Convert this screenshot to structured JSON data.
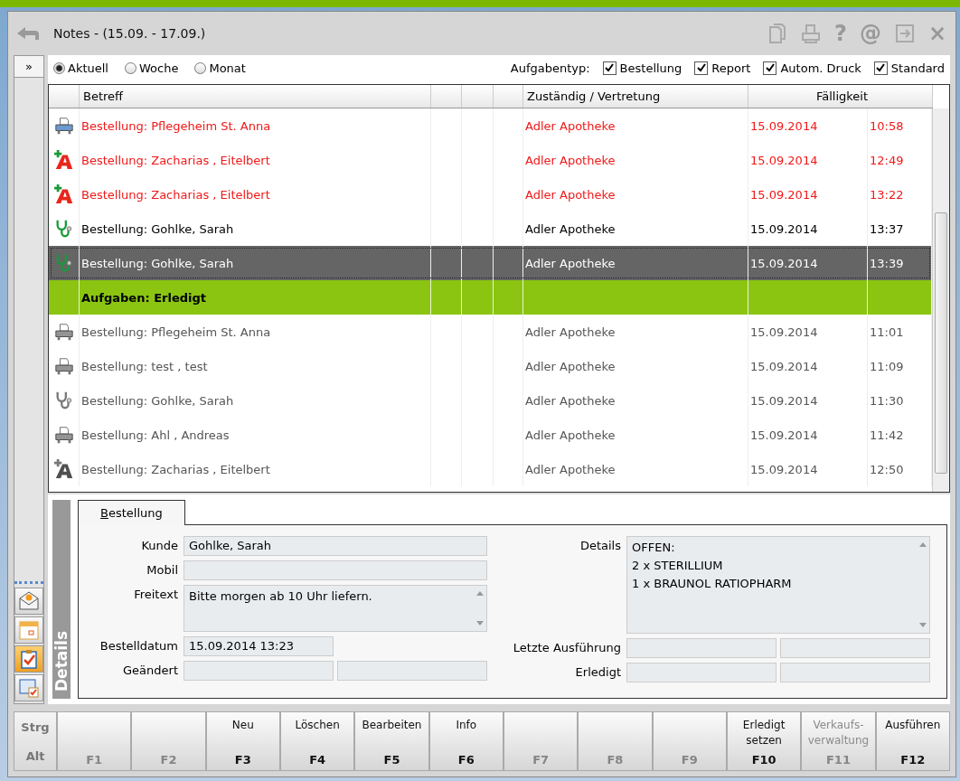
{
  "window": {
    "title": "Notes - (15.09. - 17.09.)",
    "tools": [
      {
        "kind": "copy"
      },
      {
        "kind": "print"
      },
      {
        "kind": "glyph",
        "text": "?"
      },
      {
        "kind": "glyph",
        "text": "@"
      },
      {
        "kind": "exit"
      },
      {
        "kind": "glyph",
        "text": "×"
      }
    ]
  },
  "sidebar": {
    "expand": "»",
    "items": [
      {
        "kind": "mail",
        "selected": false
      },
      {
        "kind": "calendar",
        "selected": false
      },
      {
        "kind": "tasks",
        "selected": true
      },
      {
        "kind": "form",
        "selected": false
      }
    ]
  },
  "period": [
    {
      "label": "Aktuell",
      "selected": true
    },
    {
      "label": "Woche",
      "selected": false
    },
    {
      "label": "Monat",
      "selected": false
    }
  ],
  "task_type": {
    "label": "Aufgabentyp:",
    "options": [
      {
        "label": "Bestellung",
        "checked": true
      },
      {
        "label": "Report",
        "checked": true
      },
      {
        "label": "Autom. Druck",
        "checked": true
      },
      {
        "label": "Standard",
        "checked": true
      }
    ]
  },
  "table": {
    "columns": [
      "Betreff",
      "Zuständig / Vertretung",
      "Fälligkeit"
    ],
    "rows": [
      {
        "kind": "task",
        "icon": {
          "kind": "printer"
        },
        "overdue": true,
        "done": false,
        "selected": false,
        "subject": "Bestellung: Pflegeheim St. Anna",
        "assignee": "Adler Apotheke",
        "date": "15.09.2014",
        "time": "10:58"
      },
      {
        "kind": "task",
        "icon": {
          "kind": "pharmacy"
        },
        "overdue": true,
        "done": false,
        "selected": false,
        "subject": "Bestellung: Zacharias , Eitelbert",
        "assignee": "Adler Apotheke",
        "date": "15.09.2014",
        "time": "12:49"
      },
      {
        "kind": "task",
        "icon": {
          "kind": "pharmacy"
        },
        "overdue": true,
        "done": false,
        "selected": false,
        "subject": "Bestellung: Zacharias , Eitelbert",
        "assignee": "Adler Apotheke",
        "date": "15.09.2014",
        "time": "13:22"
      },
      {
        "kind": "task",
        "icon": {
          "kind": "stethoscope"
        },
        "overdue": false,
        "done": false,
        "selected": false,
        "subject": "Bestellung: Gohlke, Sarah",
        "assignee": "Adler Apotheke",
        "date": "15.09.2014",
        "time": "13:37"
      },
      {
        "kind": "task",
        "icon": {
          "kind": "stethoscope"
        },
        "overdue": false,
        "done": false,
        "selected": true,
        "subject": "Bestellung: Gohlke, Sarah",
        "assignee": "Adler Apotheke",
        "date": "15.09.2014",
        "time": "13:39"
      },
      {
        "kind": "group",
        "label": "Aufgaben: Erledigt"
      },
      {
        "kind": "task",
        "icon": {
          "kind": "printer"
        },
        "overdue": false,
        "done": true,
        "selected": false,
        "subject": "Bestellung: Pflegeheim St. Anna",
        "assignee": "Adler Apotheke",
        "date": "15.09.2014",
        "time": "11:01"
      },
      {
        "kind": "task",
        "icon": {
          "kind": "printer"
        },
        "overdue": false,
        "done": true,
        "selected": false,
        "subject": "Bestellung: test , test",
        "assignee": "Adler Apotheke",
        "date": "15.09.2014",
        "time": "11:09"
      },
      {
        "kind": "task",
        "icon": {
          "kind": "stethoscope"
        },
        "overdue": false,
        "done": true,
        "selected": false,
        "subject": "Bestellung: Gohlke, Sarah",
        "assignee": "Adler Apotheke",
        "date": "15.09.2014",
        "time": "11:30"
      },
      {
        "kind": "task",
        "icon": {
          "kind": "printer"
        },
        "overdue": false,
        "done": true,
        "selected": false,
        "subject": "Bestellung: Ahl , Andreas",
        "assignee": "Adler Apotheke",
        "date": "15.09.2014",
        "time": "11:42"
      },
      {
        "kind": "task",
        "icon": {
          "kind": "pharmacy"
        },
        "overdue": false,
        "done": true,
        "selected": false,
        "subject": "Bestellung: Zacharias , Eitelbert",
        "assignee": "Adler Apotheke",
        "date": "15.09.2014",
        "time": "12:50"
      }
    ]
  },
  "details": {
    "side_label": "Details",
    "tab": "Bestellung",
    "left": [
      {
        "kind": "single",
        "label": "Kunde",
        "value": "Gohlke, Sarah"
      },
      {
        "kind": "single",
        "label": "Mobil"
      },
      {
        "kind": "memo",
        "label": "Freitext",
        "lines": [
          "Bitte morgen ab 10 Uhr liefern."
        ]
      },
      {
        "kind": "short",
        "label": "Bestelldatum",
        "value": "15.09.2014 13:23"
      },
      {
        "kind": "double",
        "label": "Geändert"
      }
    ],
    "right": [
      {
        "kind": "memo",
        "label": "Details",
        "lines": [
          "OFFEN:",
          "2 x STERILLIUM",
          "1 x BRAUNOL RATIOPHARM"
        ]
      },
      {
        "kind": "double",
        "label": "Letzte Ausführung"
      },
      {
        "kind": "double",
        "label": "Erledigt"
      }
    ]
  },
  "function_keys": {
    "modifiers": [
      "Strg",
      "Alt"
    ],
    "keys": [
      {
        "key": "F1",
        "disabled": true
      },
      {
        "key": "F2",
        "disabled": true
      },
      {
        "key": "F3",
        "label": "Neu",
        "disabled": false
      },
      {
        "key": "F4",
        "label": "Löschen",
        "disabled": false
      },
      {
        "key": "F5",
        "label": "Bearbeiten",
        "disabled": false
      },
      {
        "key": "F6",
        "label": "Info",
        "disabled": false
      },
      {
        "key": "F7",
        "disabled": true
      },
      {
        "key": "F8",
        "disabled": true
      },
      {
        "key": "F9",
        "disabled": true
      },
      {
        "key": "F10",
        "label": "Erledigt setzen",
        "disabled": false
      },
      {
        "key": "F11",
        "label": "Verkaufs-verwaltung",
        "disabled": true
      },
      {
        "key": "F12",
        "label": "Ausführen",
        "disabled": false
      }
    ]
  }
}
